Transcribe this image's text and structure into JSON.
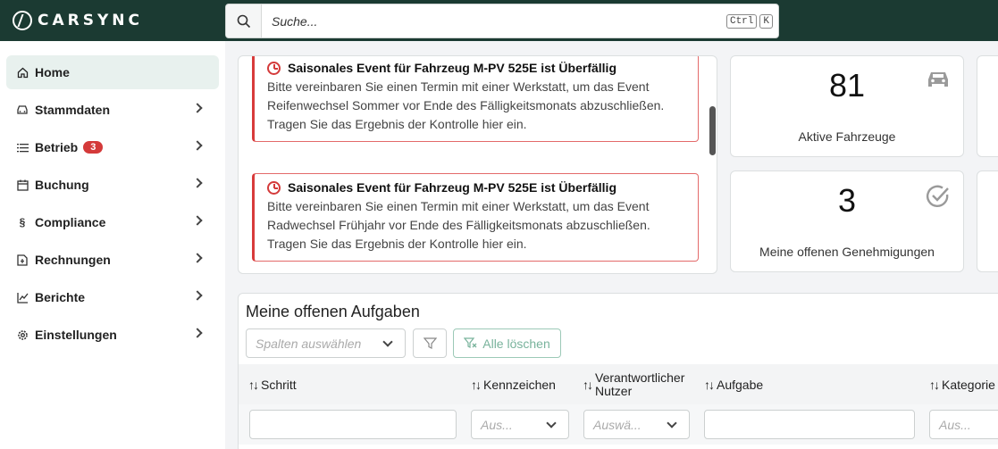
{
  "app": {
    "brand": "CARSYNC"
  },
  "search": {
    "placeholder": "Suche...",
    "shortcut_key1": "Ctrl",
    "shortcut_key2": "K"
  },
  "sidebar": {
    "items": [
      {
        "label": "Home",
        "icon": "home-icon"
      },
      {
        "label": "Stammdaten",
        "icon": "car-icon"
      },
      {
        "label": "Betrieb",
        "icon": "list-icon",
        "badge": "3"
      },
      {
        "label": "Buchung",
        "icon": "calendar-icon"
      },
      {
        "label": "Compliance",
        "icon": "section-icon"
      },
      {
        "label": "Rechnungen",
        "icon": "invoice-icon"
      },
      {
        "label": "Berichte",
        "icon": "chart-icon"
      },
      {
        "label": "Einstellungen",
        "icon": "gear-icon"
      }
    ]
  },
  "notifications": [
    {
      "title": "Saisonales Event für Fahrzeug M-PV 525E ist Überfällig",
      "body": "Bitte vereinbaren Sie einen Termin mit einer Werkstatt, um das Event Reifenwechsel Sommer vor Ende des Fälligkeitsmonats abzuschließen. Tragen Sie das Ergebnis der Kontrolle hier ein."
    },
    {
      "title": "Saisonales Event für Fahrzeug M-PV 525E ist Überfällig",
      "body": "Bitte vereinbaren Sie einen Termin mit einer Werkstatt, um das Event Radwechsel Frühjahr vor Ende des Fälligkeitsmonats abzuschließen. Tragen Sie das Ergebnis der Kontrolle hier ein."
    }
  ],
  "stats": [
    {
      "value": "81",
      "label": "Aktive Fahrzeuge",
      "icon": "car-icon"
    },
    {
      "value": "3",
      "label": "Meine offenen Genehmigungen",
      "icon": "check-circle-icon"
    }
  ],
  "tasks": {
    "title": "Meine offenen Aufgaben",
    "columns_placeholder": "Spalten auswählen",
    "clear_label": "Alle löschen",
    "headers": [
      "Schritt",
      "Kennzeichen",
      "Verantwortlicher",
      "Nutzer",
      "Aufgabe",
      "Kategorie"
    ],
    "filters": {
      "kennzeichen": "Aus...",
      "verantwortlicher": "Auswä...",
      "kategorie": "Aus..."
    }
  },
  "colors": {
    "topbar": "#1b3a32",
    "active": "#e8f1ee",
    "alert": "#d43a3a",
    "accent": "#79b39c"
  }
}
